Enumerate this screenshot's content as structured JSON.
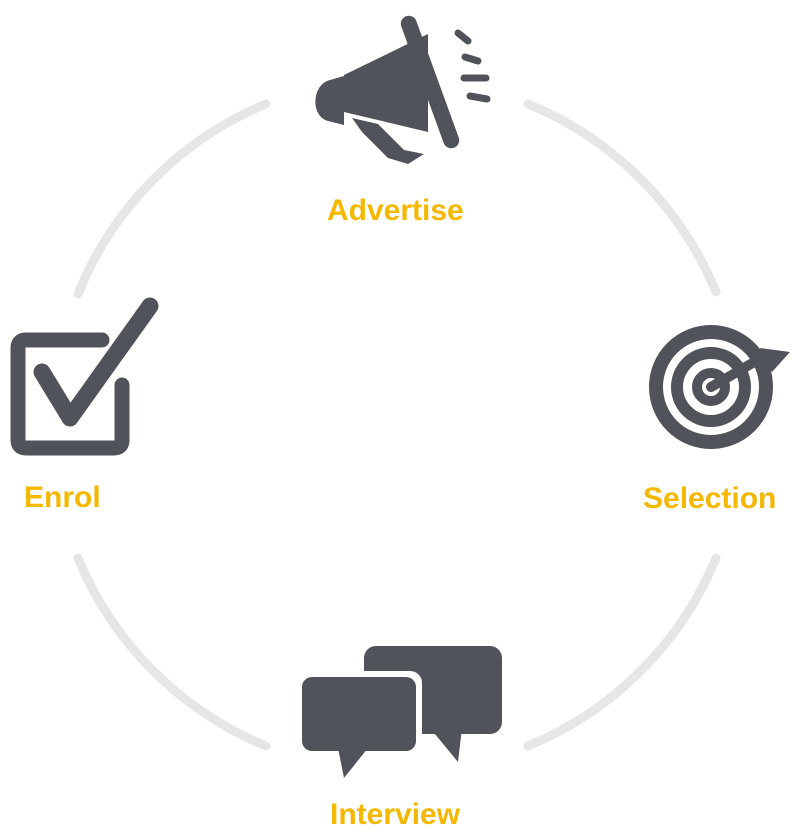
{
  "diagram": {
    "type": "cycle",
    "steps": [
      {
        "label": "Advertise",
        "icon": "megaphone-icon"
      },
      {
        "label": "Selection",
        "icon": "target-icon"
      },
      {
        "label": "Interview",
        "icon": "speech-bubbles-icon"
      },
      {
        "label": "Enrol",
        "icon": "checkbox-icon"
      }
    ],
    "colors": {
      "label": "#f5b800",
      "icon": "#505359",
      "ring": "#e6e6e6"
    }
  }
}
